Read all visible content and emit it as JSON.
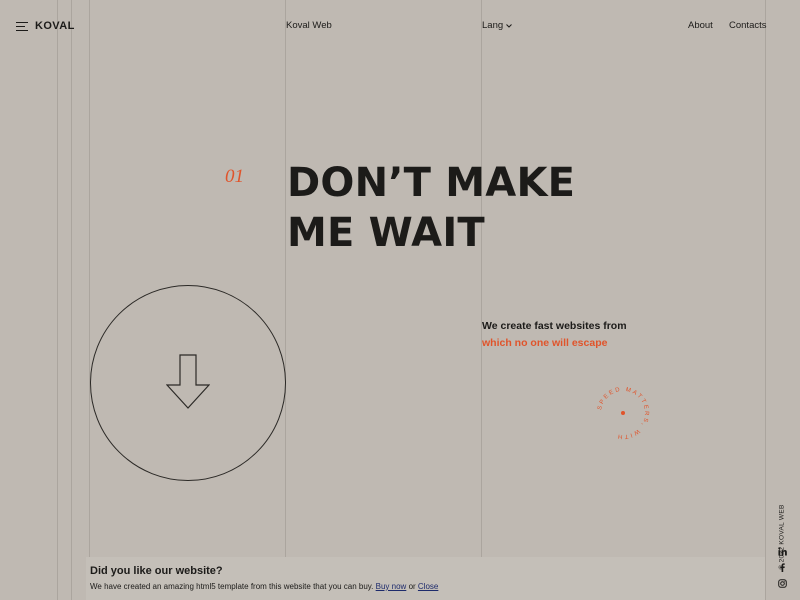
{
  "header": {
    "logo": "KOVAL",
    "center_link": "Koval Web",
    "lang_label": "Lang",
    "nav": [
      {
        "label": "About"
      },
      {
        "label": "Contacts"
      }
    ]
  },
  "hero": {
    "index": "01",
    "title_line1": "DON’T MAKE",
    "title_line2": "ME WAIT",
    "tagline_line1": "We create fast websites from",
    "tagline_line2": "which no one will escape",
    "badge_text": "SPEED MATTERS, WITH"
  },
  "sidebar": {
    "copyright": "© 2022 KOVAL WEB",
    "social_icons": [
      "linkedin-icon",
      "facebook-icon",
      "instagram-icon"
    ]
  },
  "banner": {
    "title": "Did you like our website?",
    "text": "We have created an amazing html5 template from this website that you can buy.",
    "buy_label": "Buy now",
    "or_label": "or",
    "close_label": "Close"
  },
  "colors": {
    "background": "#bfb9b2",
    "accent": "#e0542b",
    "text": "#1c1b19",
    "link": "#1d2a6b"
  }
}
